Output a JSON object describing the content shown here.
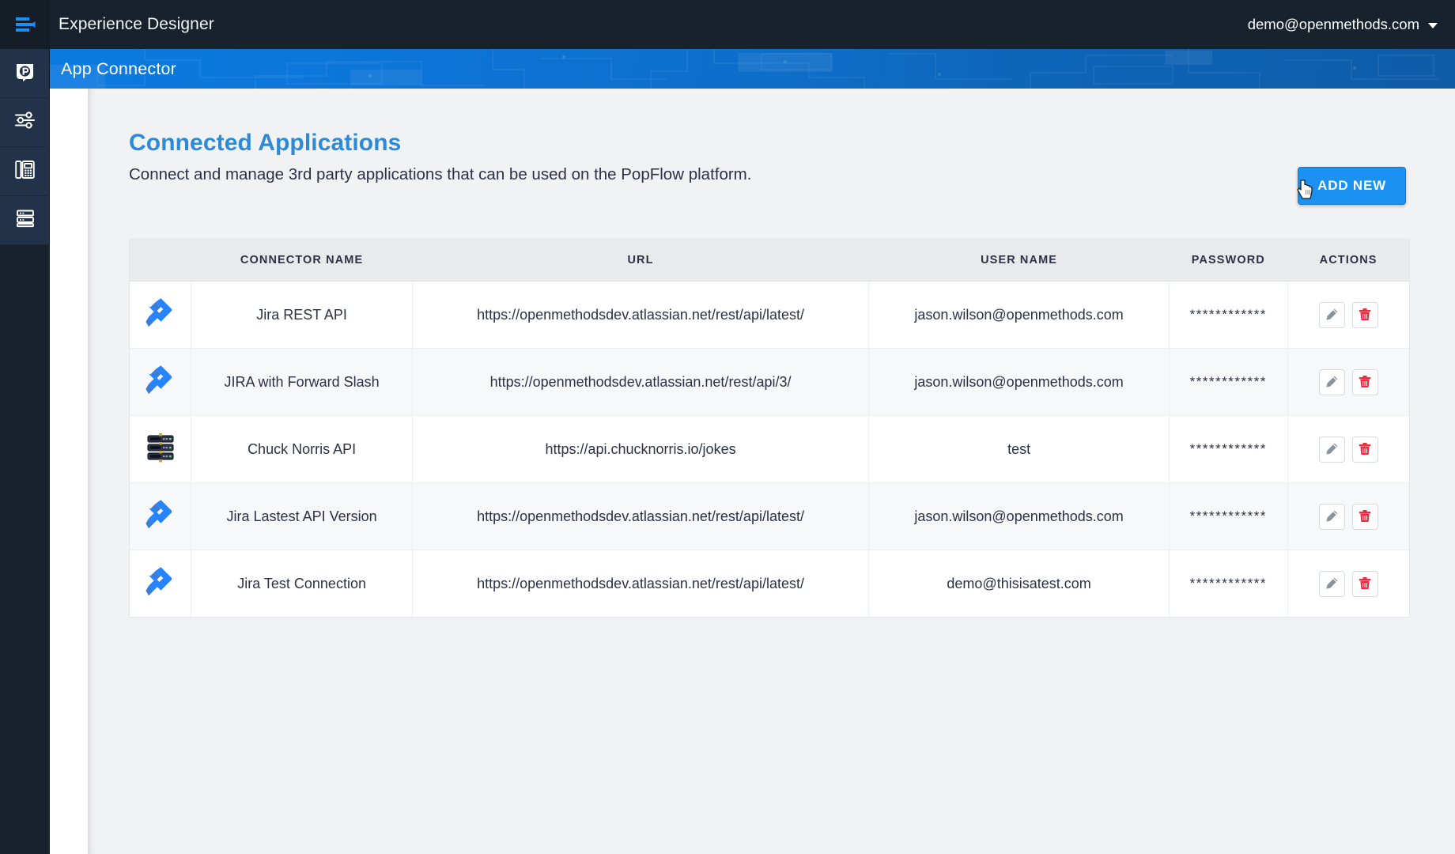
{
  "topbar": {
    "menu_icon": "hamburger-menu-icon",
    "title": "Experience Designer",
    "user_email": "demo@openmethods.com",
    "caret_icon": "chevron-down-icon"
  },
  "sidebar": {
    "items": [
      {
        "icon": "popflow-p-logo-icon",
        "label": "PopFlow"
      },
      {
        "icon": "sliders-settings-icon",
        "label": "Settings"
      },
      {
        "icon": "desk-phone-icon",
        "label": "Phone"
      },
      {
        "icon": "server-rack-icon",
        "label": "Connectors"
      }
    ]
  },
  "banner": {
    "title": "App Connector"
  },
  "page": {
    "title": "Connected Applications",
    "subtitle": "Connect and manage 3rd party applications that can be used on the PopFlow platform.",
    "add_new_label": "ADD NEW",
    "accent_color": "#2e8ad6",
    "button_color": "#1b92f2",
    "cursor_icon": "pointing-hand-cursor"
  },
  "table": {
    "columns": [
      "",
      "CONNECTOR NAME",
      "URL",
      "USER NAME",
      "PASSWORD",
      "ACTIONS"
    ],
    "edit_icon": "pencil-edit-icon",
    "delete_icon": "trash-delete-icon",
    "rows": [
      {
        "icon": "jira-logo-icon",
        "name": "Jira REST API",
        "url": "https://openmethodsdev.atlassian.net/rest/api/latest/",
        "username": "jason.wilson@openmethods.com",
        "password": "************"
      },
      {
        "icon": "jira-logo-icon",
        "name": "JIRA with Forward Slash",
        "url": "https://openmethodsdev.atlassian.net/rest/api/3/",
        "username": "jason.wilson@openmethods.com",
        "password": "************"
      },
      {
        "icon": "server-rack-icon",
        "name": "Chuck Norris API",
        "url": "https://api.chucknorris.io/jokes",
        "username": "test",
        "password": "************"
      },
      {
        "icon": "jira-logo-icon",
        "name": "Jira Lastest API Version",
        "url": "https://openmethodsdev.atlassian.net/rest/api/latest/",
        "username": "jason.wilson@openmethods.com",
        "password": "************"
      },
      {
        "icon": "jira-logo-icon",
        "name": "Jira Test Connection",
        "url": "https://openmethodsdev.atlassian.net/rest/api/latest/",
        "username": "demo@thisisatest.com",
        "password": "************"
      }
    ]
  }
}
